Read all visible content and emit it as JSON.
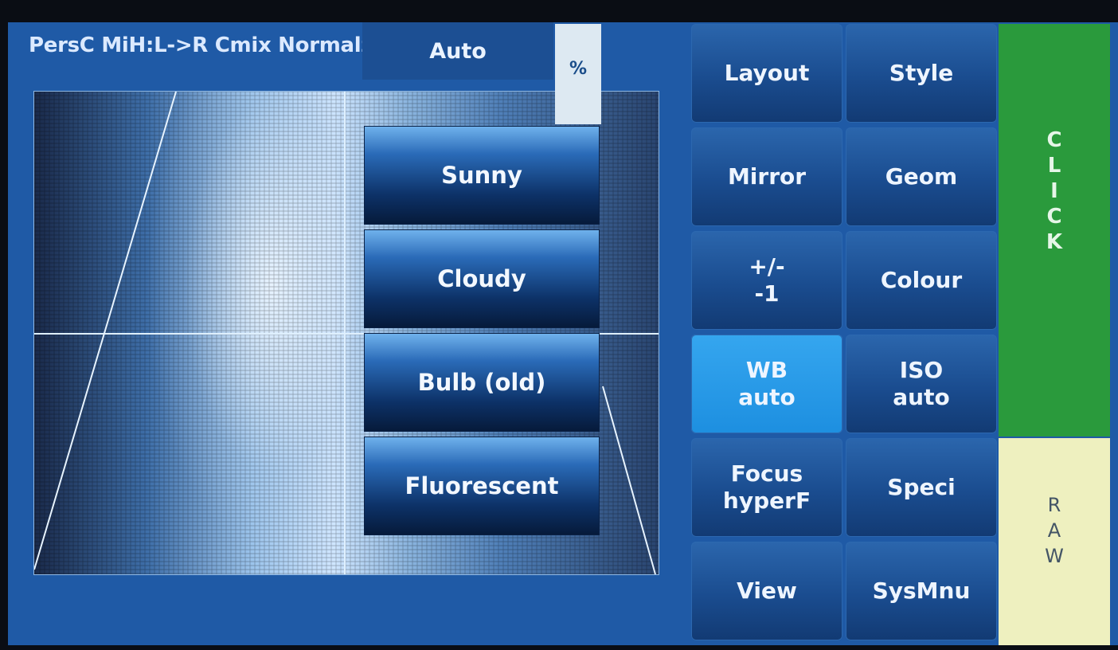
{
  "title": "PersC MiH:L->R Cmix Normalz",
  "wb_menu": {
    "current": "Auto",
    "percent": "%",
    "options": [
      "Sunny",
      "Cloudy",
      "Bulb (old)",
      "Fluorescent"
    ]
  },
  "buttons": [
    {
      "line1": "Layout",
      "line2": ""
    },
    {
      "line1": "Style",
      "line2": ""
    },
    {
      "line1": "Mirror",
      "line2": ""
    },
    {
      "line1": "Geom",
      "line2": ""
    },
    {
      "line1": "+/-",
      "line2": "-1"
    },
    {
      "line1": "Colour",
      "line2": ""
    },
    {
      "line1": "WB",
      "line2": "auto"
    },
    {
      "line1": "ISO",
      "line2": "auto"
    },
    {
      "line1": "Focus",
      "line2": "hyperF"
    },
    {
      "line1": "Speci",
      "line2": ""
    },
    {
      "line1": "View",
      "line2": ""
    },
    {
      "line1": "SysMnu",
      "line2": ""
    }
  ],
  "click_letters": [
    "C",
    "L",
    "I",
    "C",
    "K"
  ],
  "raw_letters": [
    "R",
    "A",
    "W"
  ],
  "colors": {
    "background": "#1f5aa6",
    "button": "#1a4c8f",
    "active_button": "#1d8fe0",
    "click_panel": "#2a9a3c",
    "raw_panel": "#eef0bf"
  }
}
